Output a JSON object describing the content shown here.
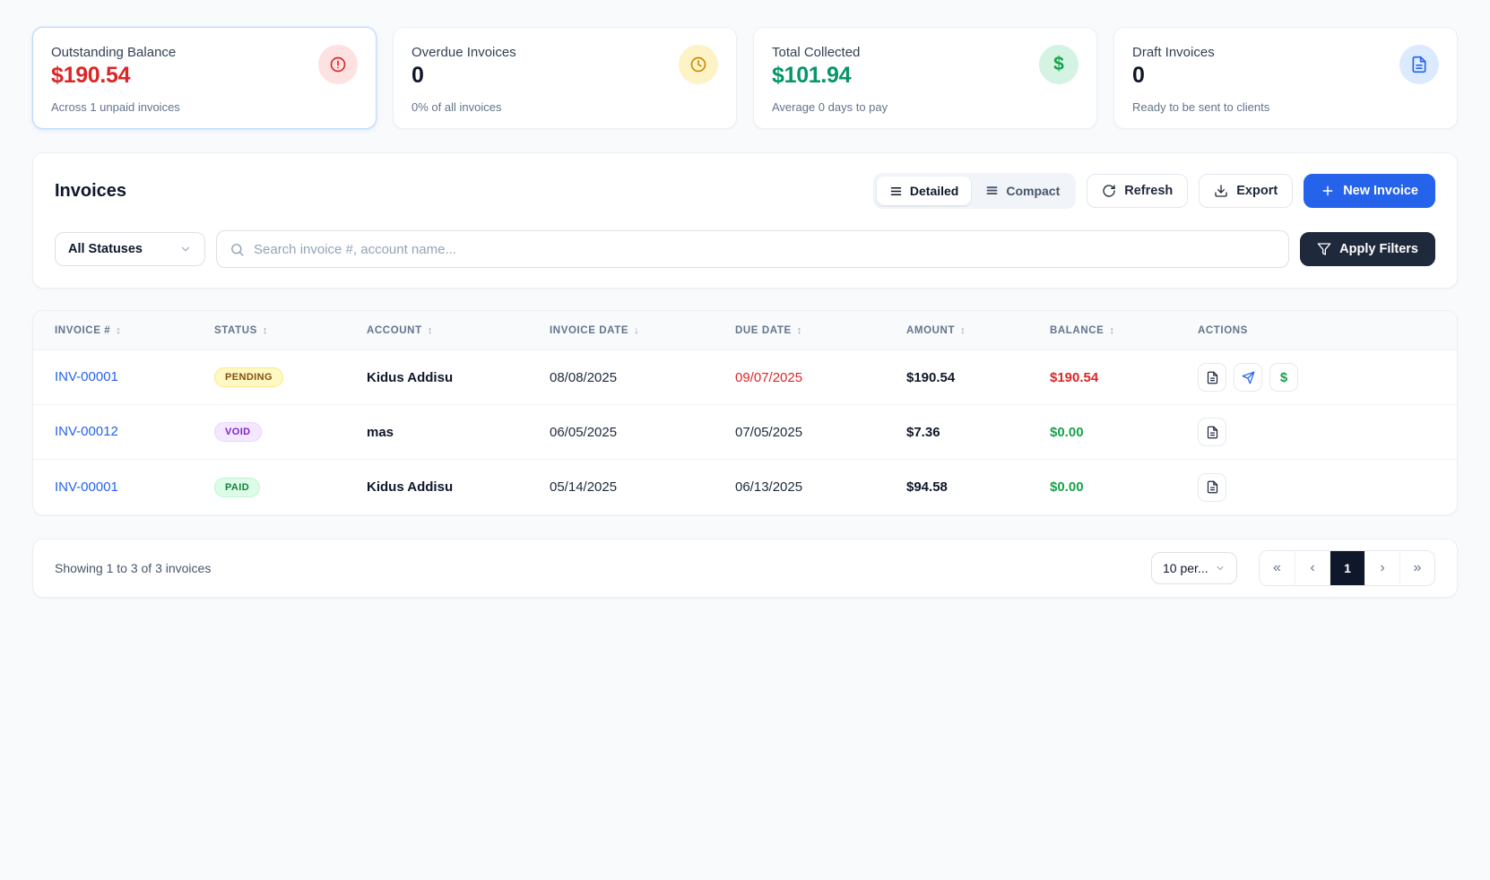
{
  "page": {
    "background": "#f8fafc"
  },
  "stats": [
    {
      "title": "Outstanding Balance",
      "value": "$190.54",
      "subtitle": "Across 1 unpaid invoices",
      "icon": "alert-circle-icon",
      "accent": "#dc2626",
      "icon_bg": "#fee2e2",
      "highlight_border": "#bfdbfe"
    },
    {
      "title": "Overdue Invoices",
      "value": "0",
      "subtitle": "0% of all invoices",
      "icon": "clock-icon",
      "accent": "#ca8a04",
      "icon_bg": "#fdf3c7"
    },
    {
      "title": "Total Collected",
      "value": "$101.94",
      "subtitle": "Average 0 days to pay",
      "icon": "dollar-icon",
      "accent": "#059669",
      "icon_bg": "#d4f3e2"
    },
    {
      "title": "Draft Invoices",
      "value": "0",
      "subtitle": "Ready to be sent to clients",
      "icon": "file-icon",
      "accent": "#2563eb",
      "icon_bg": "#dbeafe"
    }
  ],
  "toolbar": {
    "heading": "Invoices",
    "view_toggle": {
      "detailed": "Detailed",
      "compact": "Compact",
      "active": "Detailed"
    },
    "refresh_label": "Refresh",
    "export_label": "Export",
    "new_invoice_label": "New Invoice",
    "new_invoice_color": "#2563eb",
    "status_filter_value": "All Statuses",
    "search_placeholder": "Search invoice #, account name...",
    "search_value": "",
    "apply_filters_label": "Apply Filters",
    "apply_filters_color": "#1e293b"
  },
  "table": {
    "columns": [
      {
        "label": "INVOICE #",
        "sort": "↕"
      },
      {
        "label": "STATUS",
        "sort": "↕"
      },
      {
        "label": "ACCOUNT",
        "sort": "↕"
      },
      {
        "label": "INVOICE DATE",
        "sort": "↓"
      },
      {
        "label": "DUE DATE",
        "sort": "↕"
      },
      {
        "label": "AMOUNT",
        "sort": "↕"
      },
      {
        "label": "BALANCE",
        "sort": "↕"
      },
      {
        "label": "ACTIONS",
        "sort": ""
      }
    ],
    "rows": [
      {
        "invoice": "INV-00001",
        "status": "PENDING",
        "account": "Kidus Addisu",
        "invoice_date": "08/08/2025",
        "due_date": "09/07/2025",
        "due_date_color": "#dc2626",
        "amount": "$190.54",
        "balance": "$190.54",
        "balance_color": "#dc2626",
        "actions": [
          "view-invoice",
          "send-invoice",
          "record-payment"
        ]
      },
      {
        "invoice": "INV-00012",
        "status": "VOID",
        "account": "mas",
        "invoice_date": "06/05/2025",
        "due_date": "07/05/2025",
        "due_date_color": "#1e293b",
        "amount": "$7.36",
        "balance": "$0.00",
        "balance_color": "#16a34a",
        "actions": [
          "view-invoice"
        ]
      },
      {
        "invoice": "INV-00001",
        "status": "PAID",
        "account": "Kidus Addisu",
        "invoice_date": "05/14/2025",
        "due_date": "06/13/2025",
        "due_date_color": "#1e293b",
        "amount": "$94.58",
        "balance": "$0.00",
        "balance_color": "#16a34a",
        "actions": [
          "view-invoice"
        ]
      }
    ],
    "status_colors": {
      "PENDING": {
        "bg": "#fef9c3",
        "text": "#854d0e"
      },
      "VOID": {
        "bg": "#f3e8ff",
        "text": "#7e22ce"
      },
      "PAID": {
        "bg": "#dcfce7",
        "text": "#15803d"
      }
    },
    "link_color": "#2563eb"
  },
  "footer": {
    "summary": "Showing 1 to 3 of 3 invoices",
    "per_page": "10 per...",
    "pagination": {
      "first": "«",
      "prev": "‹",
      "page": "1",
      "next": "›",
      "last": "»"
    }
  }
}
